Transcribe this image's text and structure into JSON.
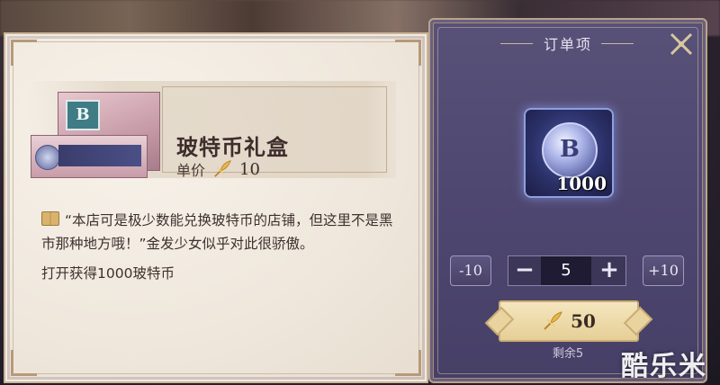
{
  "item": {
    "name": "玻特币礼盒",
    "price_label": "单价",
    "price_value": "10",
    "description": "“本店可是极少数能兑换玻特币的店铺，但这里不是黑市那种地方哦！”金发少女似乎对此很骄傲。",
    "effect": "打开获得1000玻特币",
    "box_brand_letter": "B"
  },
  "order_panel": {
    "title": "订单项",
    "item_quantity": "1000",
    "coin_letter": "B",
    "minus10_label": "-10",
    "plus10_label": "+10",
    "minus_label": "−",
    "plus_label": "+",
    "quantity": "5",
    "total_price": "50",
    "remaining": "剩余5",
    "close_icon": "crossed-swords-close-icon"
  },
  "watermark": "酷乐米",
  "colors": {
    "panel_bg": "#4e4770",
    "paper_bg": "#efe7dc",
    "gold_button": "#e6cf97"
  }
}
